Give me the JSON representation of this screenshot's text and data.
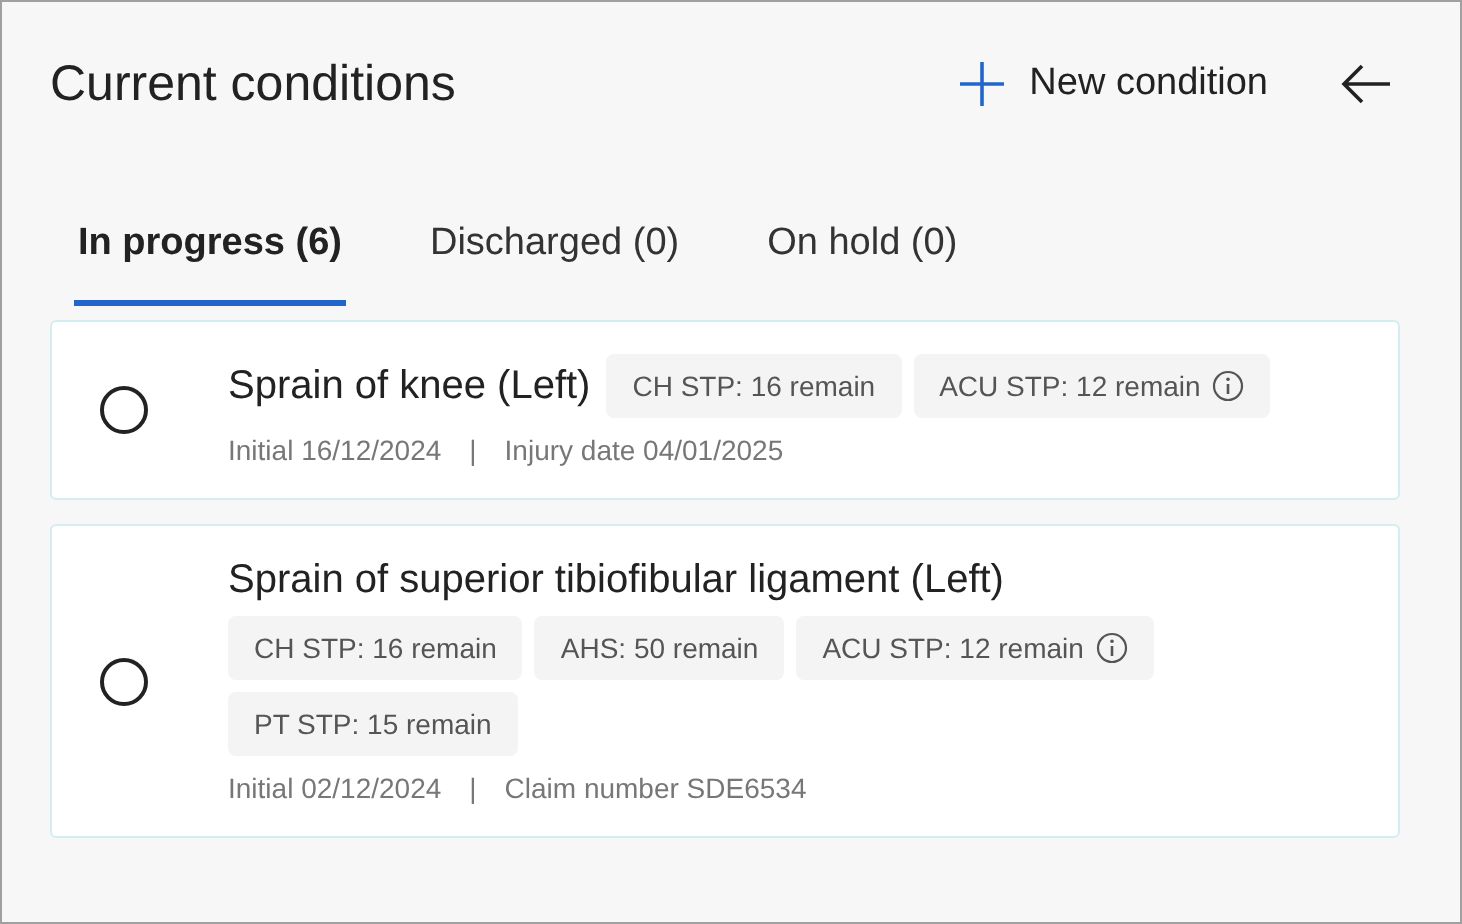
{
  "header": {
    "title": "Current conditions",
    "new_button": "New condition"
  },
  "tabs": [
    {
      "label": "In progress (6)",
      "selected": true
    },
    {
      "label": "Discharged (0)",
      "selected": false
    },
    {
      "label": "On hold (0)",
      "selected": false
    }
  ],
  "conditions": [
    {
      "title": "Sprain of knee (Left)",
      "selected": false,
      "chips": [
        {
          "label": "CH STP: 16 remain",
          "info": false
        },
        {
          "label": "ACU STP: 12 remain",
          "info": true
        }
      ],
      "meta": {
        "initial": "Initial 16/12/2024",
        "separator": "|",
        "detail": "Injury date 04/01/2025"
      }
    },
    {
      "title": "Sprain of superior tibiofibular ligament (Left)",
      "selected": false,
      "chips": [
        {
          "label": "CH STP: 16 remain",
          "info": false
        },
        {
          "label": "AHS: 50 remain",
          "info": false
        },
        {
          "label": "ACU STP: 12 remain",
          "info": true
        },
        {
          "label": "PT STP: 15 remain",
          "info": false
        }
      ],
      "meta": {
        "initial": "Initial 02/12/2024",
        "separator": "|",
        "detail": "Claim number SDE6534"
      }
    }
  ]
}
